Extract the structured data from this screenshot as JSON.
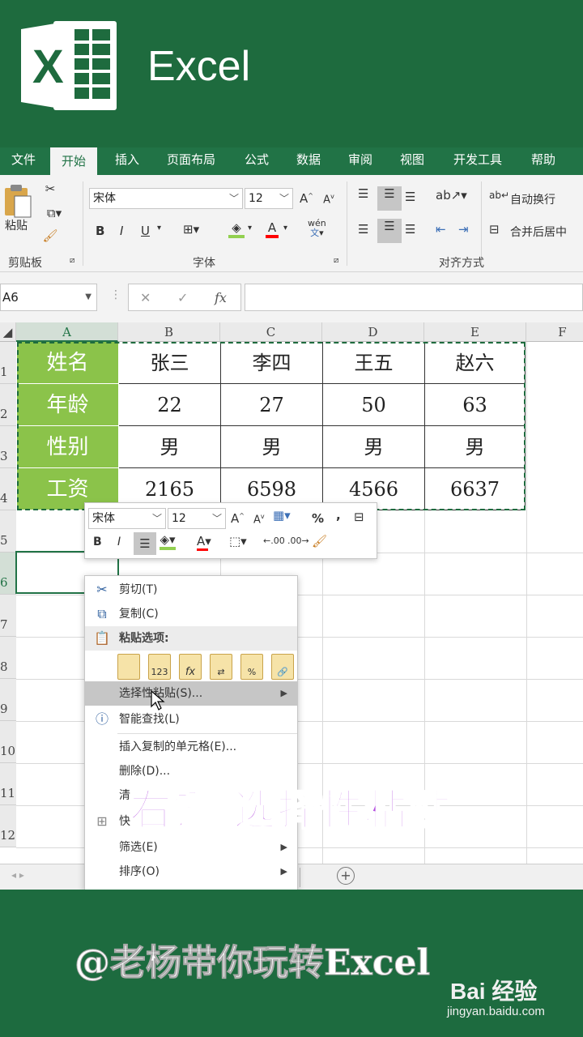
{
  "app": {
    "title": "Excel"
  },
  "ribbon_tabs": [
    {
      "label": "文件"
    },
    {
      "label": "开始"
    },
    {
      "label": "插入"
    },
    {
      "label": "页面布局"
    },
    {
      "label": "公式"
    },
    {
      "label": "数据"
    },
    {
      "label": "审阅"
    },
    {
      "label": "视图"
    },
    {
      "label": "开发工具"
    },
    {
      "label": "帮助"
    }
  ],
  "ribbon": {
    "paste_label": "粘贴",
    "clipboard_group": "剪贴板",
    "font_name": "宋体",
    "font_size": "12",
    "font_group": "字体",
    "bold": "B",
    "italic": "I",
    "underline": "U",
    "font_color": "A",
    "phonetic": "wén",
    "grow_font": "A",
    "shrink_font": "A",
    "wrap_text": "自动换行",
    "merge_center": "合并后居中",
    "align_group": "对齐方式"
  },
  "formula_bar": {
    "name_box": "A6",
    "cancel": "✕",
    "enter": "✓",
    "fx": "fx",
    "value": ""
  },
  "columns": [
    "A",
    "B",
    "C",
    "D",
    "E",
    "F"
  ],
  "rows": [
    "1",
    "2",
    "3",
    "4",
    "5",
    "6",
    "7",
    "8",
    "9",
    "10",
    "11",
    "12"
  ],
  "table": [
    [
      "姓名",
      "张三",
      "李四",
      "王五",
      "赵六"
    ],
    [
      "年龄",
      "22",
      "27",
      "50",
      "63"
    ],
    [
      "性别",
      "男",
      "男",
      "男",
      "男"
    ],
    [
      "工资",
      "2165",
      "6598",
      "4566",
      "6637"
    ]
  ],
  "mini_toolbar": {
    "font_name": "宋体",
    "font_size": "12",
    "percent": "%",
    "comma": ",",
    "bold": "B",
    "italic": "I",
    "font_color": "A",
    "inc_decimal": ".00",
    "dec_decimal": ".00"
  },
  "context_menu": {
    "cut": "剪切(T)",
    "copy": "复制(C)",
    "paste_options": "粘贴选项:",
    "paste_special": "选择性粘贴(S)...",
    "smart_lookup": "智能查找(L)",
    "insert_copied": "插入复制的单元格(E)...",
    "delete": "删除(D)...",
    "clear": "清",
    "quick": "快",
    "filter": "筛选(E)",
    "sort": "排序(O)",
    "paste_icon_values": "123",
    "paste_icon_formulas": "fx"
  },
  "overlay_caption": "右键 选择性粘贴",
  "footer": {
    "text": "@老杨带你玩转Excel",
    "watermark": "Bai 经验",
    "watermark_url": "jingyan.baidu.com"
  },
  "colors": {
    "excel_green": "#217346",
    "header_cell": "#8bc34a",
    "caption": "#b44fe0"
  }
}
